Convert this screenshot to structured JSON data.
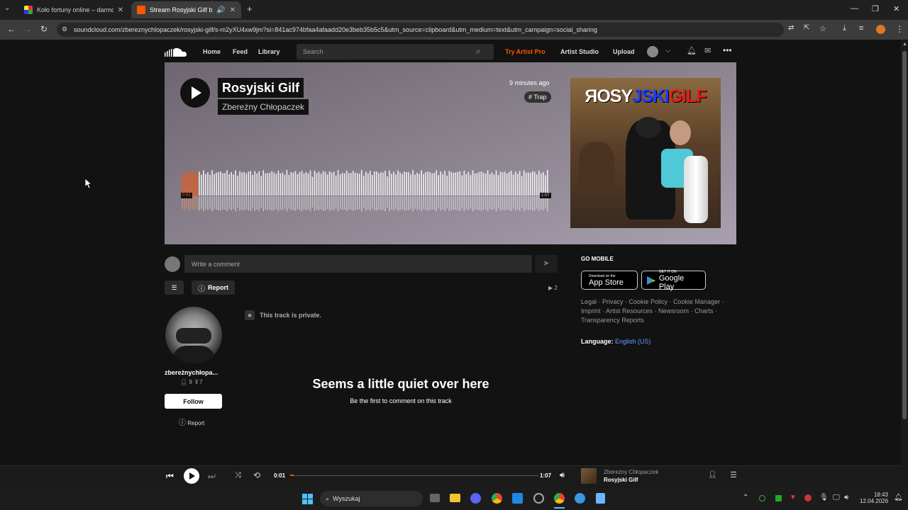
{
  "browser": {
    "tabs": [
      {
        "title": "Koło fortuny online – darmowe"
      },
      {
        "title": "Stream Rosyjski Gilf by zbe"
      }
    ],
    "url": "soundcloud.com/zbereznychlopaczek/rosyjski-gilf/s-m2yXU4xw9jm?si=841ac974bfaa4afaadd20e3beb35b5c5&utm_source=clipboard&utm_medium=text&utm_campaign=social_sharing"
  },
  "header": {
    "home": "Home",
    "feed": "Feed",
    "library": "Library",
    "search_placeholder": "Search",
    "try_pro": "Try Artist Pro",
    "artist_studio": "Artist Studio",
    "upload": "Upload"
  },
  "track": {
    "title": "Rosyjski Gilf",
    "artist": "Zbereżny Chłopaczek",
    "posted": "9 minutes ago",
    "tag": "# Trap",
    "time_current": "0:01",
    "time_total": "1:07",
    "progress": 0.015,
    "artwork_text_1": "ЯOSY",
    "artwork_text_2": "JSKI",
    "artwork_text_3": "GILF"
  },
  "comments": {
    "placeholder": "Write a comment",
    "report": "Report",
    "plays": "2",
    "private": "This track is private.",
    "empty_title": "Seems a little quiet over here",
    "empty_sub": "Be the first to comment on this track"
  },
  "profile": {
    "name": "zbereżnychłopa...",
    "followers": "9",
    "tracks": "7",
    "follow": "Follow",
    "report": "Report"
  },
  "sidebar": {
    "go_mobile": "GO MOBILE",
    "appstore_small": "Download on the",
    "appstore_big": "App Store",
    "gplay_small": "GET IT ON",
    "gplay_big": "Google Play",
    "links": "Legal · Privacy · Cookie Policy · Cookie Manager · Imprint · Artist Resources · Newsroom · Charts · Transparency Reports",
    "language_label": "Language:",
    "language_value": "English (US)"
  },
  "player": {
    "time_current": "0:01",
    "time_total": "1:07",
    "artist": "Zbereżny Chłopaczek",
    "title": "Rosyjski Gilf"
  },
  "taskbar": {
    "search": "Wyszukaj",
    "time": "18:43",
    "date": "12.04.2026"
  },
  "colors": {
    "accent": "#ff5500",
    "link": "#6b9cff"
  }
}
